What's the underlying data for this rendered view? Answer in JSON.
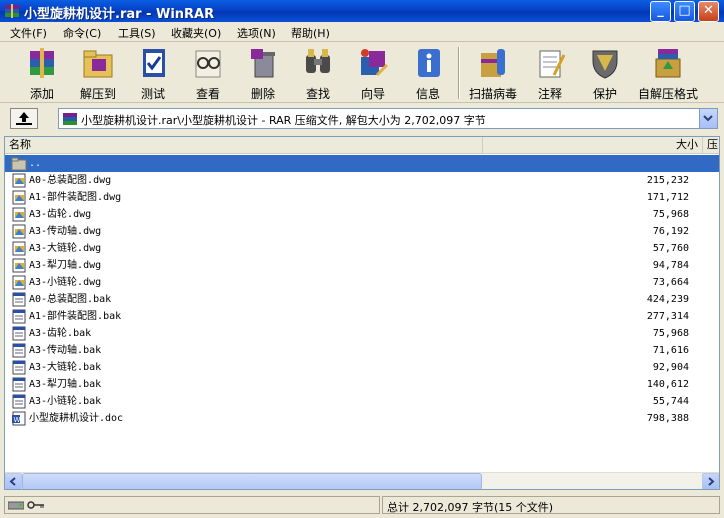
{
  "window": {
    "title": "小型旋耕机设计.rar - WinRAR",
    "minimize_glyph": "_",
    "maximize_glyph": "□",
    "close_glyph": "✕"
  },
  "menu": [
    "文件(F)",
    "命令(C)",
    "工具(S)",
    "收藏夹(O)",
    "选项(N)",
    "帮助(H)"
  ],
  "toolbar": [
    {
      "label": "添加",
      "icon": "add-books-icon"
    },
    {
      "label": "解压到",
      "icon": "extract-folder-icon"
    },
    {
      "label": "测试",
      "icon": "test-clipboard-icon"
    },
    {
      "label": "查看",
      "icon": "view-glasses-icon"
    },
    {
      "label": "删除",
      "icon": "delete-trash-icon"
    },
    {
      "label": "查找",
      "icon": "find-binoculars-icon"
    },
    {
      "label": "向导",
      "icon": "wizard-magic-icon"
    },
    {
      "label": "信息",
      "icon": "info-icon"
    },
    {
      "label": "扫描病毒",
      "icon": "virus-scan-icon"
    },
    {
      "label": "注释",
      "icon": "comment-notepad-icon"
    },
    {
      "label": "保护",
      "icon": "protect-shield-icon"
    },
    {
      "label": "自解压格式",
      "icon": "sfx-box-icon"
    }
  ],
  "address": {
    "path": "小型旋耕机设计.rar\\小型旋耕机设计 - RAR 压缩文件, 解包大小为 2,702,097 字节"
  },
  "columns": {
    "name": "名称",
    "size": "大小",
    "packed": "压"
  },
  "files": [
    {
      "name": "..",
      "size": "",
      "type": "parent"
    },
    {
      "name": "A0-总装配图.dwg",
      "size": "215,232",
      "type": "dwg"
    },
    {
      "name": "A1-部件装配图.dwg",
      "size": "171,712",
      "type": "dwg"
    },
    {
      "name": "A3-齿轮.dwg",
      "size": "75,968",
      "type": "dwg"
    },
    {
      "name": "A3-传动轴.dwg",
      "size": "76,192",
      "type": "dwg"
    },
    {
      "name": "A3-大链轮.dwg",
      "size": "57,760",
      "type": "dwg"
    },
    {
      "name": "A3-犁刀轴.dwg",
      "size": "94,784",
      "type": "dwg"
    },
    {
      "name": "A3-小链轮.dwg",
      "size": "73,664",
      "type": "dwg"
    },
    {
      "name": "A0-总装配图.bak",
      "size": "424,239",
      "type": "bak"
    },
    {
      "name": "A1-部件装配图.bak",
      "size": "277,314",
      "type": "bak"
    },
    {
      "name": "A3-齿轮.bak",
      "size": "75,968",
      "type": "bak"
    },
    {
      "name": "A3-传动轴.bak",
      "size": "71,616",
      "type": "bak"
    },
    {
      "name": "A3-大链轮.bak",
      "size": "92,904",
      "type": "bak"
    },
    {
      "name": "A3-犁刀轴.bak",
      "size": "140,612",
      "type": "bak"
    },
    {
      "name": "A3-小链轮.bak",
      "size": "55,744",
      "type": "bak"
    },
    {
      "name": "小型旋耕机设计.doc",
      "size": "798,388",
      "type": "doc"
    }
  ],
  "status": {
    "summary": "总计 2,702,097 字节(15 个文件)"
  }
}
